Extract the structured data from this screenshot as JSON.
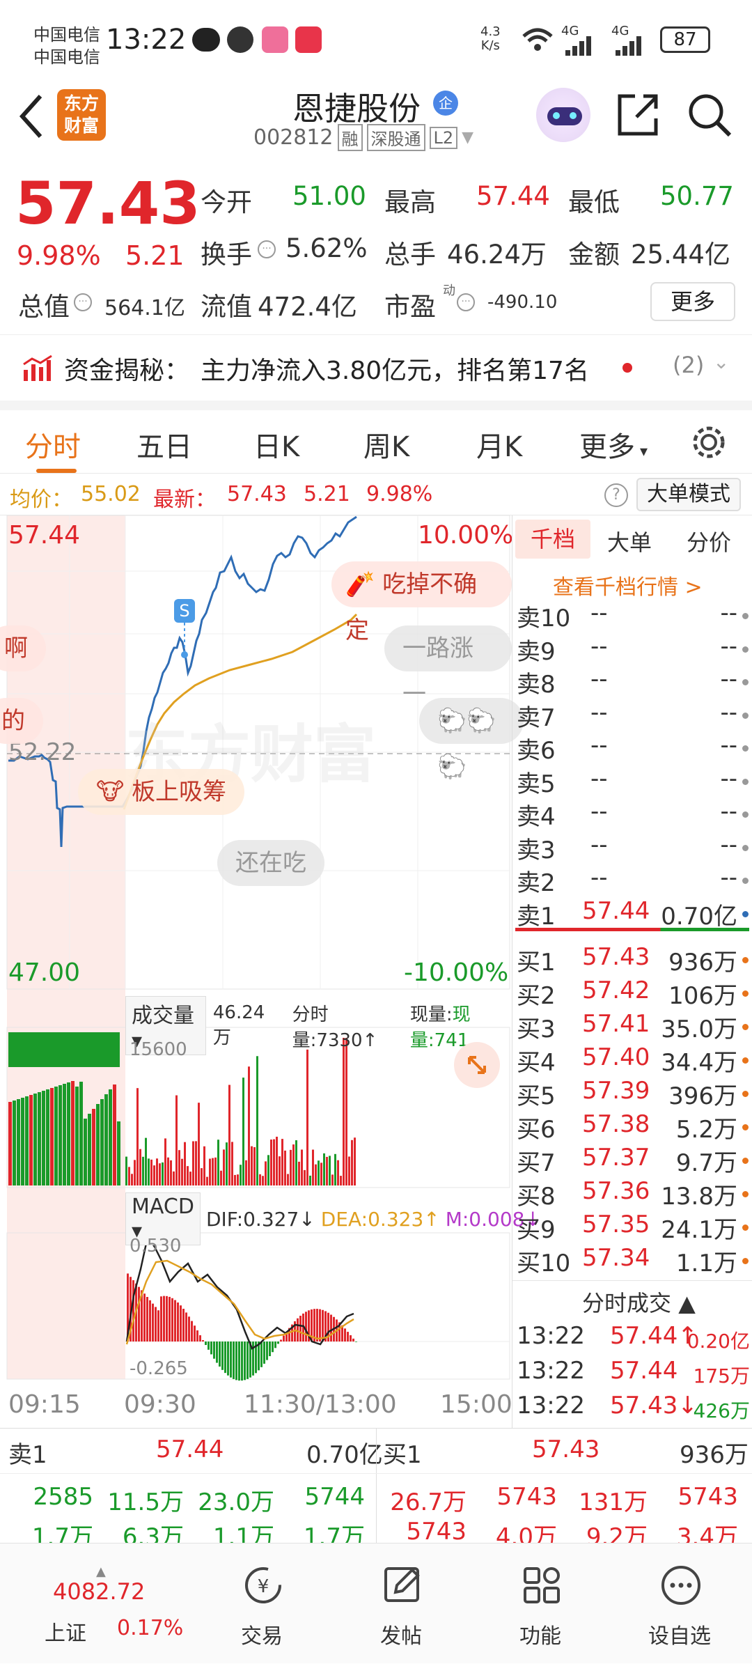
{
  "status": {
    "carrier1": "中国电信",
    "carrier2": "中国电信",
    "time": "13:22",
    "speed_value": "4.3",
    "speed_unit": "K/s",
    "net1": "4G",
    "net2": "4G",
    "battery": "87"
  },
  "header": {
    "logo_line1": "东方",
    "logo_line2": "财富",
    "stock_name": "恩捷股份",
    "badge": "企",
    "code": "002812",
    "tag1": "融",
    "tag2": "深股通",
    "tag3": "L2"
  },
  "quote": {
    "price": "57.43",
    "pct": "9.98%",
    "change": "5.21",
    "open_label": "今开",
    "open": "51.00",
    "high_label": "最高",
    "high": "57.44",
    "low_label": "最低",
    "low": "50.77",
    "turnover_label": "换手",
    "turnover": "5.62%",
    "volume_label": "总手",
    "volume": "46.24万",
    "amount_label": "金额",
    "amount": "25.44亿",
    "mktcap_label": "总值",
    "mktcap": "564.1亿",
    "float_label": "流值",
    "float": "472.4亿",
    "pe_label": "市盈",
    "pe_sup": "动",
    "pe": "-490.10",
    "more": "更多"
  },
  "fund": {
    "label": "资金揭秘：",
    "text": "主力净流入3.80亿元，排名第17名",
    "count": "(2)"
  },
  "tabs": [
    "分时",
    "五日",
    "日K",
    "周K",
    "月K",
    "更多"
  ],
  "avgbar": {
    "avg_label": "均价：",
    "avg": "55.02",
    "last_label": "最新：",
    "last": "57.43",
    "chg": "5.21",
    "pct": "9.98%",
    "mode": "大单模式"
  },
  "chart": {
    "y_top": "57.44",
    "y_mid": "52.22",
    "y_bot": "47.00",
    "pct_top": "10.00%",
    "pct_bot": "-10.00%",
    "s_marker": "S",
    "vol_label": "成交量",
    "vol_total": "46.24万",
    "vol_time": "分时量:7330↑",
    "vol_now": "现量:741",
    "vol_max": "15600",
    "macd_label": "MACD",
    "dif": "DIF:0.327↓",
    "dea": "DEA:0.323↑",
    "m": "M:0.008↓",
    "macd_top": "0.530",
    "macd_bot": "-0.265",
    "times": [
      "09:15",
      "09:30",
      "11:30/13:00",
      "15:00"
    ],
    "watermark": "东方财富"
  },
  "danmaku": [
    "吃掉不确定",
    "一路涨一",
    "啊",
    "的",
    "板上吸筹",
    "还在吃"
  ],
  "book": {
    "tabs": [
      "千档",
      "大单",
      "分价"
    ],
    "link": "查看千档行情 >",
    "sells": [
      {
        "label": "卖10",
        "price": "--",
        "vol": "--"
      },
      {
        "label": "卖9",
        "price": "--",
        "vol": "--"
      },
      {
        "label": "卖8",
        "price": "--",
        "vol": "--"
      },
      {
        "label": "卖7",
        "price": "--",
        "vol": "--"
      },
      {
        "label": "卖6",
        "price": "--",
        "vol": "--"
      },
      {
        "label": "卖5",
        "price": "--",
        "vol": "--"
      },
      {
        "label": "卖4",
        "price": "--",
        "vol": "--"
      },
      {
        "label": "卖3",
        "price": "--",
        "vol": "--"
      },
      {
        "label": "卖2",
        "price": "--",
        "vol": "--"
      },
      {
        "label": "卖1",
        "price": "57.44",
        "vol": "0.70亿"
      }
    ],
    "buys": [
      {
        "label": "买1",
        "price": "57.43",
        "vol": "936万"
      },
      {
        "label": "买2",
        "price": "57.42",
        "vol": "106万"
      },
      {
        "label": "买3",
        "price": "57.41",
        "vol": "35.0万"
      },
      {
        "label": "买4",
        "price": "57.40",
        "vol": "34.4万"
      },
      {
        "label": "买5",
        "price": "57.39",
        "vol": "396万"
      },
      {
        "label": "买6",
        "price": "57.38",
        "vol": "5.2万"
      },
      {
        "label": "买7",
        "price": "57.37",
        "vol": "9.7万"
      },
      {
        "label": "买8",
        "price": "57.36",
        "vol": "13.8万"
      },
      {
        "label": "买9",
        "price": "57.35",
        "vol": "24.1万"
      },
      {
        "label": "买10",
        "price": "57.34",
        "vol": "1.1万"
      }
    ],
    "trades_title": "分时成交",
    "trades": [
      {
        "time": "13:22",
        "price": "57.44↑",
        "vol": "0.20亿"
      },
      {
        "time": "13:22",
        "price": "57.44",
        "vol": "175万"
      },
      {
        "time": "13:22",
        "price": "57.43↓",
        "vol": "426万"
      }
    ]
  },
  "tape": {
    "sell_label": "卖1",
    "sell_price": "57.44",
    "sell_vol": "0.70亿",
    "buy_label": "买1",
    "buy_price": "57.43",
    "buy_vol": "936万",
    "row1_left": [
      "2585",
      "11.5万",
      "23.0万",
      "5744"
    ],
    "row1_right": [
      "26.7万",
      "5743",
      "131万",
      "5743"
    ],
    "row2_left": [
      "1.7万",
      "6.3万",
      "1.1万",
      "1.7万"
    ],
    "row2_right": [
      "5743",
      "4.0万",
      "9.2万",
      "3.4万"
    ]
  },
  "nav": {
    "index_value": "4082.72",
    "index_name": "上证",
    "index_pct": "0.17%",
    "trade": "交易",
    "post": "发帖",
    "func": "功能",
    "fav": "设自选"
  },
  "colors": {
    "up": "#e0262b",
    "down": "#1a9a2a",
    "accent": "#e8731a",
    "price_line": "#2f6db5",
    "avg_line": "#e0a020"
  }
}
